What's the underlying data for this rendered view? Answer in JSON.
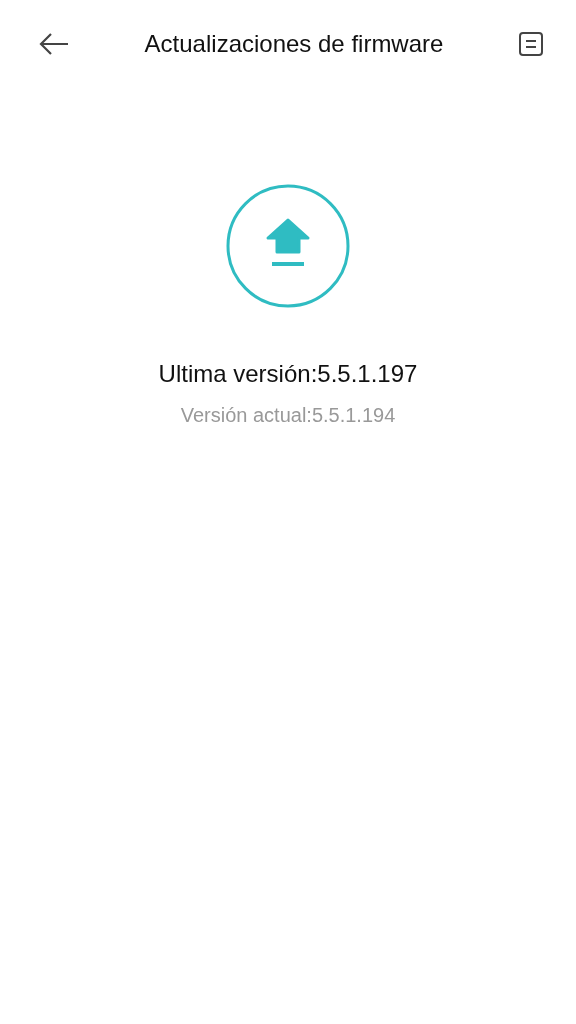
{
  "header": {
    "title": "Actualizaciones de firmware"
  },
  "update": {
    "latest": "Ultima versión:5.5.1.197",
    "current": "Versión actual:5.5.1.194"
  }
}
